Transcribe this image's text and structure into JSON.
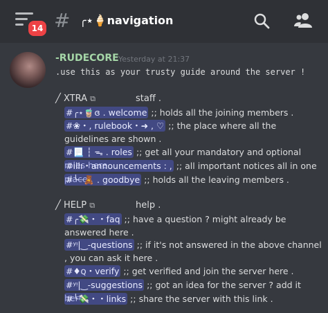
{
  "header": {
    "badge_count": "14",
    "hash": "#",
    "channel_name": "╭⋆🍦navigation"
  },
  "message": {
    "author": "-RUDECORE",
    "timestamp": "Yesterday at 21:37",
    "intro": ".use this as your trusty guide around the server !"
  },
  "sections": [
    {
      "title": "XTRA",
      "copy_glyph": "⧉",
      "right": "staff .",
      "items": [
        {
          "mention": "#╭⋆🧋ɞ . welcome",
          "text": ";; holds all the joining members ."
        },
        {
          "mention": "#❀・, rulebook・➜ , ♡",
          "text": ";; the place where all the guidelines are shown ."
        },
        {
          "mention": "#📃 ┆ ᯓ . roles",
          "text": ";; get all your mandatory and optional roles here ."
        },
        {
          "mention": "#ıllı・announcements : ,",
          "text": ";; all important notices all in one place ."
        },
        {
          "mention": "#╰┈🧸 . goodbye",
          "text": ";; holds all the leaving members ."
        }
      ]
    },
    {
      "title": "HELP",
      "copy_glyph": "⧉",
      "right": "help .",
      "items": [
        {
          "mention": "#╭💸・・faq",
          "text": ";; have a question ? might already be answered here ."
        },
        {
          "mention": "#ʸᵎ|‿-questions",
          "text": ";; if it's not answered in the above channel , you can ask it here ."
        },
        {
          "mention": "#♦︎ꞯ・verify",
          "text": ";; get verified and join the server here ."
        },
        {
          "mention": "#ʸᵎ|‿-suggestions",
          "text": ";; got an idea for the server ? add it here ."
        },
        {
          "mention": "#╰💸・・links",
          "text": ";; share the server with this link ."
        }
      ]
    }
  ],
  "colors": {
    "background": "#36393f",
    "topbar": "#2f3136",
    "author": "#a5d6a7",
    "mention_bg": "#5865f2",
    "badge": "#ed4245"
  },
  "icons": [
    "hamburger-menu-icon",
    "hash-icon",
    "search-icon",
    "members-icon",
    "copy-icon"
  ]
}
